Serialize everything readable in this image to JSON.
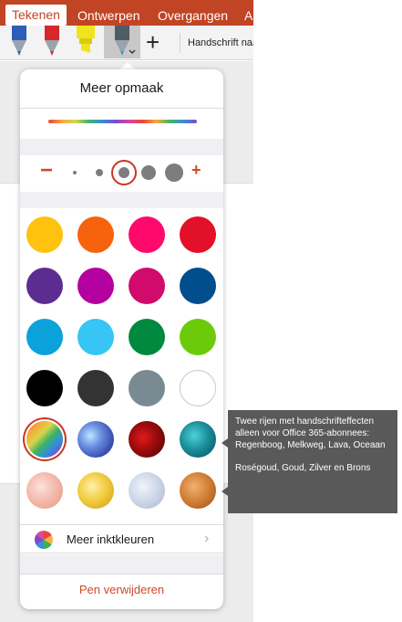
{
  "ribbon": {
    "tabs": [
      "Tekenen",
      "Ontwerpen",
      "Overgangen",
      "A"
    ],
    "handwriting_label": "Handschrift naa"
  },
  "popover": {
    "title": "Meer opmaak",
    "size_minus": "−",
    "size_plus": "+",
    "colors": [
      [
        "#ffc20e",
        "#f7630c",
        "#ff0a6c",
        "#e3102a"
      ],
      [
        "#5c2d91",
        "#b4009e",
        "#d10a6c",
        "#004e8c"
      ],
      [
        "#0ba2dc",
        "#36c5f4",
        "#00893e",
        "#6bcb0b"
      ],
      [
        "#000000",
        "#333333",
        "#7a8a93",
        "#ffffff"
      ]
    ],
    "effects_row1": [
      "Regenboog",
      "Melkweg",
      "Lava",
      "Oceaan"
    ],
    "effects_row2": [
      "Roségoud",
      "Goud",
      "Zilver",
      "Brons"
    ],
    "more_colors_label": "Meer inktkleuren",
    "delete_label": "Pen verwijderen"
  },
  "callout": {
    "text1": "Twee rijen met handschrifteffecten alleen voor Office 365-abonnees: Regenboog, Melkweg, Lava, Oceaan",
    "text2": "Roségoud, Goud, Zilver en Brons"
  }
}
